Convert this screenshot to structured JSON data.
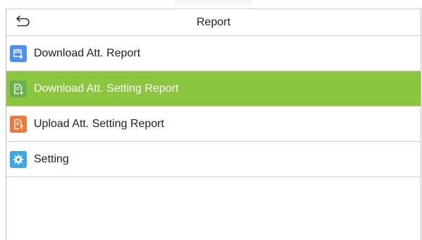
{
  "header": {
    "title": "Report",
    "back_icon": "back-arrow-icon"
  },
  "menu": {
    "items": [
      {
        "label": "Download Att. Report",
        "icon": "calendar-download-icon",
        "icon_color": "#4d8ff5",
        "selected": false
      },
      {
        "label": "Download Att. Setting Report",
        "icon": "document-download-icon",
        "icon_color": "#67b14f",
        "selected": true
      },
      {
        "label": "Upload Att. Setting Report",
        "icon": "document-upload-icon",
        "icon_color": "#f0783a",
        "selected": false
      },
      {
        "label": "Setting",
        "icon": "gear-icon",
        "icon_color": "#3aa8e8",
        "selected": false
      }
    ]
  },
  "colors": {
    "selected_row": "#8cc63e",
    "divider": "#cfcfcf"
  }
}
